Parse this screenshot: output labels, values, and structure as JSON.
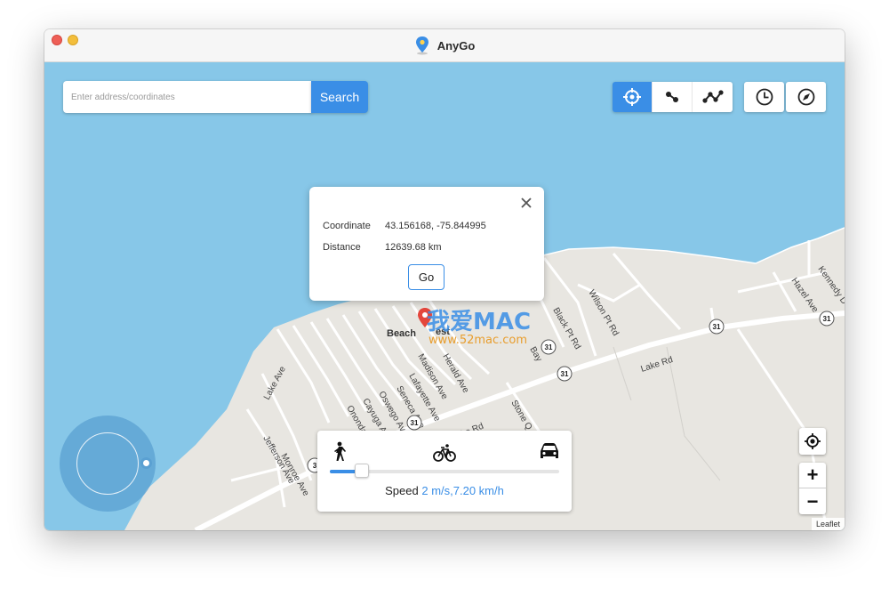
{
  "window": {
    "title": "AnyGo",
    "app_icon": "map-pin-icon"
  },
  "toolbar": {
    "search_placeholder": "Enter address/coordinates",
    "search_label": "Search",
    "modes": [
      {
        "icon": "crosshair-icon",
        "active": true
      },
      {
        "icon": "two-spot-route-icon",
        "active": false
      },
      {
        "icon": "multi-spot-route-icon",
        "active": false
      }
    ],
    "history_icon": "clock-icon",
    "compass_icon": "compass-icon"
  },
  "map": {
    "streets": [
      "Wilson Pt Rd",
      "Black Pt Rd",
      "Lake Rd",
      "Lake Rd",
      "Hazel Ave",
      "Kennedy D",
      "Lake Ave",
      "Jefferson Ave",
      "Monroe Ave",
      "Onondaga Ave",
      "Cayuga Ave",
      "Oswego Ave",
      "Seneca Ave",
      "Lafayette Ave",
      "Madison Ave",
      "Herald Ave",
      "Bay",
      "Stone Q",
      "Beach",
      "est"
    ],
    "route_markers": [
      "31",
      "31",
      "31",
      "31",
      "31",
      "3"
    ],
    "watermark_line1": "我爱MAC",
    "watermark_line2": "www.52mac.com",
    "water_color": "#87c7e8",
    "land_color": "#e8e6e1"
  },
  "popup": {
    "coordinate_label": "Coordinate",
    "coordinate_value": "43.156168, -75.844995",
    "distance_label": "Distance",
    "distance_value": "12639.68 km",
    "go_label": "Go"
  },
  "speed": {
    "walk_icon": "walking-person-icon",
    "bike_icon": "bicycle-icon",
    "car_icon": "car-icon",
    "label": "Speed",
    "value": "2 m/s,7.20 km/h",
    "slider_level": 0.14
  },
  "controls": {
    "locate_icon": "locate-icon",
    "zoom_in": "+",
    "zoom_out": "−"
  },
  "attribution": "Leaflet",
  "colors": {
    "accent": "#3a8ee6",
    "joystick": "#5aa0d2"
  }
}
